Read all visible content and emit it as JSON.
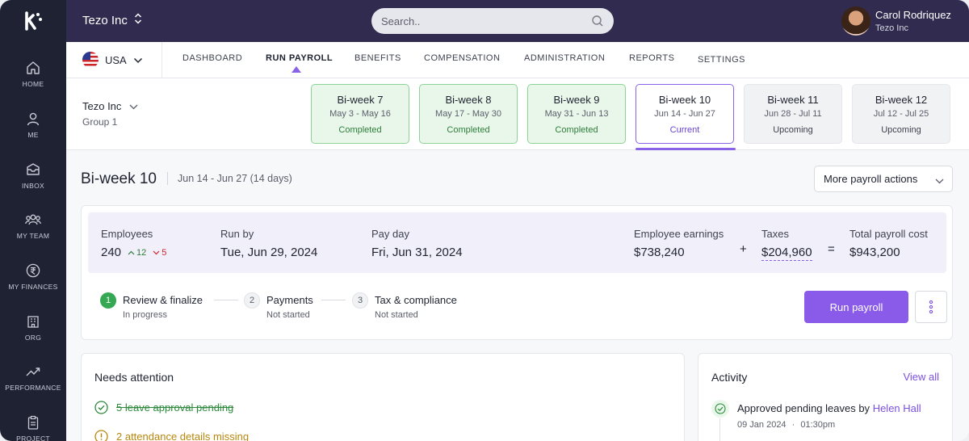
{
  "colors": {
    "sidebar_bg": "#1e2233",
    "topbar_bg": "#302b4f",
    "accent": "#8a5be8",
    "completed_bg": "#e9f7ea",
    "completed_border": "#8bd395",
    "warning": "#b8860b"
  },
  "sidebar": {
    "logo_icon": "k-logo-icon",
    "items": [
      {
        "label": "HOME",
        "icon": "home-icon"
      },
      {
        "label": "ME",
        "icon": "user-icon"
      },
      {
        "label": "INBOX",
        "icon": "inbox-icon"
      },
      {
        "label": "MY TEAM",
        "icon": "team-icon"
      },
      {
        "label": "MY FINANCES",
        "icon": "rupee-icon"
      },
      {
        "label": "ORG",
        "icon": "building-icon"
      },
      {
        "label": "PERFORMANCE",
        "icon": "trend-icon"
      },
      {
        "label": "PROJECT",
        "icon": "clipboard-icon"
      }
    ]
  },
  "topbar": {
    "company": "Tezo Inc",
    "search_placeholder": "Search..",
    "user": {
      "name": "Carol Rodriquez",
      "company": "Tezo Inc"
    }
  },
  "mainnav": {
    "country": "USA",
    "tabs": [
      {
        "label": "DASHBOARD"
      },
      {
        "label": "RUN PAYROLL",
        "active": true
      },
      {
        "label": "BENEFITS"
      },
      {
        "label": "COMPENSATION"
      },
      {
        "label": "ADMINISTRATION"
      },
      {
        "label": "REPORTS"
      },
      {
        "label": "SETTINGS"
      }
    ]
  },
  "period": {
    "group_name": "Tezo Inc",
    "group_sub": "Group 1",
    "cards": [
      {
        "title": "Bi-week 7",
        "dates": "May 3 - May 16",
        "status": "Completed"
      },
      {
        "title": "Bi-week 8",
        "dates": "May 17 - May 30",
        "status": "Completed"
      },
      {
        "title": "Bi-week 9",
        "dates": "May 31 - Jun 13",
        "status": "Completed"
      },
      {
        "title": "Bi-week 10",
        "dates": "Jun 14 - Jun 27",
        "status": "Current"
      },
      {
        "title": "Bi-week 11",
        "dates": "Jun 28 - Jul 11",
        "status": "Upcoming"
      },
      {
        "title": "Bi-week 12",
        "dates": "Jul 12 - Jul 25",
        "status": "Upcoming"
      }
    ]
  },
  "header": {
    "title": "Bi-week 10",
    "range": "Jun 14 - Jun 27 (14 days)",
    "more_actions": "More payroll actions"
  },
  "summary": {
    "employees_label": "Employees",
    "employees_value": "240",
    "employees_up": "12",
    "employees_down": "5",
    "runby_label": "Run by",
    "runby_value": "Tue, Jun 29, 2024",
    "payday_label": "Pay day",
    "payday_value": "Fri, Jun 31, 2024",
    "earnings_label": "Employee earnings",
    "earnings_value": "$738,240",
    "plus": "+",
    "taxes_label": "Taxes",
    "taxes_value": "$204,960",
    "equals": "=",
    "total_label": "Total payroll cost",
    "total_value": "$943,200"
  },
  "steps": [
    {
      "num": "1",
      "name": "Review & finalize",
      "status": "In progress"
    },
    {
      "num": "2",
      "name": "Payments",
      "status": "Not started"
    },
    {
      "num": "3",
      "name": "Tax & compliance",
      "status": "Not started"
    }
  ],
  "actions": {
    "run_payroll": "Run payroll"
  },
  "attention": {
    "title": "Needs attention",
    "items": [
      {
        "text": "5 leave approval pending",
        "state": "resolved"
      },
      {
        "text": "2 attendance details missing",
        "state": "warning"
      }
    ]
  },
  "activity": {
    "title": "Activity",
    "view_all": "View all",
    "entry": {
      "text": "Approved pending leaves by",
      "who": "Helen Hall",
      "date": "09 Jan 2024",
      "sep": "·",
      "time": "01:30pm"
    }
  }
}
